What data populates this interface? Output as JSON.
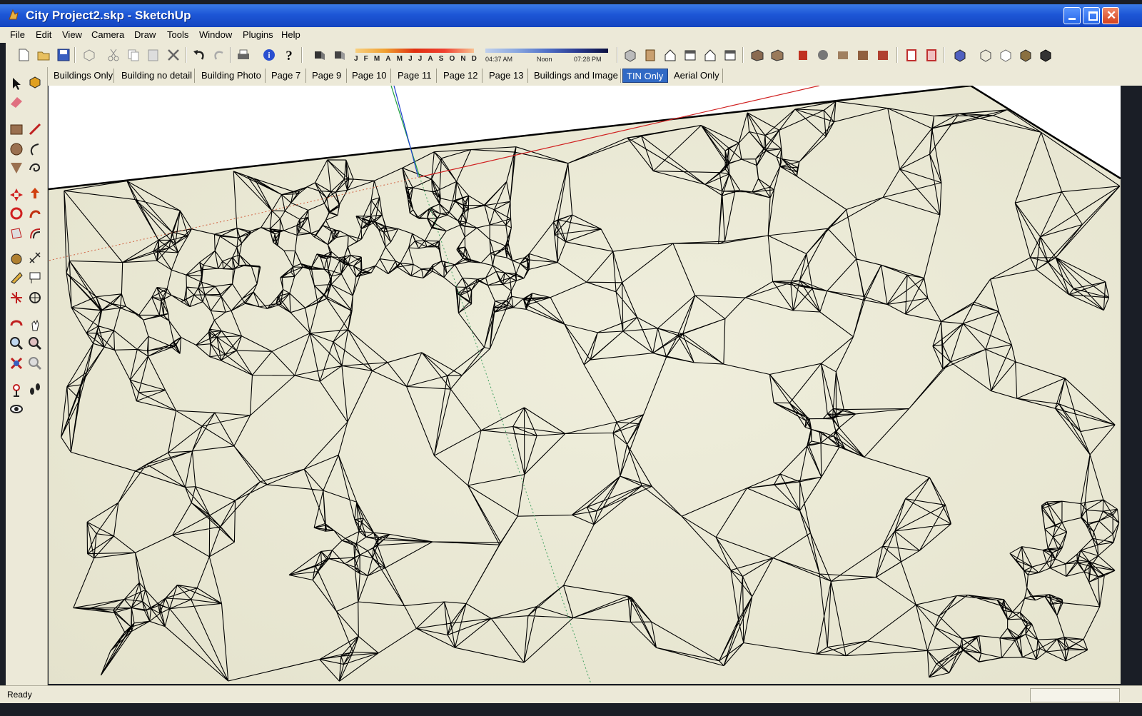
{
  "window": {
    "title": "City Project2.skp - SketchUp"
  },
  "menu": [
    "File",
    "Edit",
    "View",
    "Camera",
    "Draw",
    "Tools",
    "Window",
    "Plugins",
    "Help"
  ],
  "shadow_settings": {
    "months": [
      "J",
      "F",
      "M",
      "A",
      "M",
      "J",
      "J",
      "A",
      "S",
      "O",
      "N",
      "D"
    ],
    "time_start": "04:37 AM",
    "time_noon": "Noon",
    "time_end": "07:28 PM"
  },
  "scene_tabs": [
    {
      "label": "Buildings Only",
      "active": false
    },
    {
      "label": "Building no detail",
      "active": false
    },
    {
      "label": "Building Photo",
      "active": false
    },
    {
      "label": "Page 7",
      "active": false
    },
    {
      "label": "Page 9",
      "active": false
    },
    {
      "label": "Page 10",
      "active": false
    },
    {
      "label": "Page 11",
      "active": false
    },
    {
      "label": "Page 12",
      "active": false
    },
    {
      "label": "Page 13",
      "active": false
    },
    {
      "label": "Buildings and Image",
      "active": false
    },
    {
      "label": "TIN Only",
      "active": true
    },
    {
      "label": "Aerial Only",
      "active": false
    }
  ],
  "toolbar_icons": [
    "new-icon",
    "open-icon",
    "save-icon",
    "make-component-icon",
    "cut-icon",
    "copy-icon",
    "paste-icon",
    "erase-icon",
    "undo-icon",
    "redo-icon",
    "print-icon",
    "model-info-icon",
    "help-icon",
    "shadows-icon",
    "fog-icon",
    "iso-view-icon",
    "top-view-icon",
    "front-view-icon",
    "right-view-icon",
    "back-view-icon",
    "left-view-icon",
    "xray-icon",
    "back-edges-icon",
    "wireframe-icon",
    "hidden-line-icon",
    "shaded-icon",
    "textured-icon",
    "monochrome-icon",
    "section-plane-icon",
    "section-display-icon",
    "display-sections-icon",
    "components-icon",
    "axes-icon",
    "guides-icon",
    "profiles-icon"
  ],
  "left_tools": [
    "select-icon",
    "make-component-icon",
    "eraser-icon",
    "rectangle-icon",
    "line-icon",
    "circle-icon",
    "arc-icon",
    "polygon-icon",
    "freehand-icon",
    "move-icon",
    "push-pull-icon",
    "rotate-icon",
    "follow-me-icon",
    "scale-icon",
    "offset-icon",
    "tape-measure-icon",
    "dimension-icon",
    "protractor-icon",
    "text-icon",
    "axes-icon",
    "3d-text-icon",
    "orbit-icon",
    "pan-icon",
    "zoom-icon",
    "zoom-window-icon",
    "zoom-extents-icon",
    "previous-view-icon",
    "position-camera-icon",
    "walk-icon",
    "look-around-icon"
  ],
  "status": {
    "text": "Ready",
    "measurements": ""
  },
  "colors": {
    "titlebar": "#1d56d6",
    "chrome": "#ece9d8",
    "terrain": "#ecebd8",
    "edges": "#000000",
    "active_tab": "#316ac5"
  }
}
